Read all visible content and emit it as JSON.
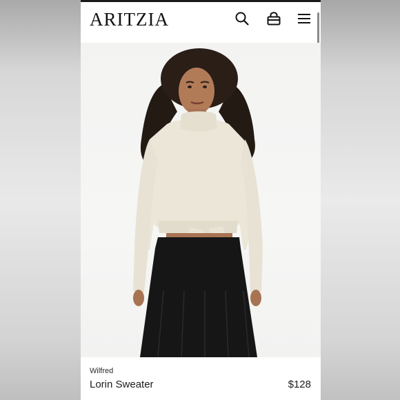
{
  "header": {
    "logo": "ARITZIA",
    "icons": [
      "search-icon",
      "bag-icon",
      "menu-icon"
    ]
  },
  "product": {
    "brand": "Wilfred",
    "name": "Lorin Sweater",
    "price": "$128",
    "image_alt": "Model wearing a cream turtleneck tie-front cropped sweater with a black pleated skirt"
  },
  "colors": {
    "text": "#1c1c1c",
    "background": "#ffffff",
    "sweater": "#ebe6d8",
    "skirt": "#161616"
  }
}
